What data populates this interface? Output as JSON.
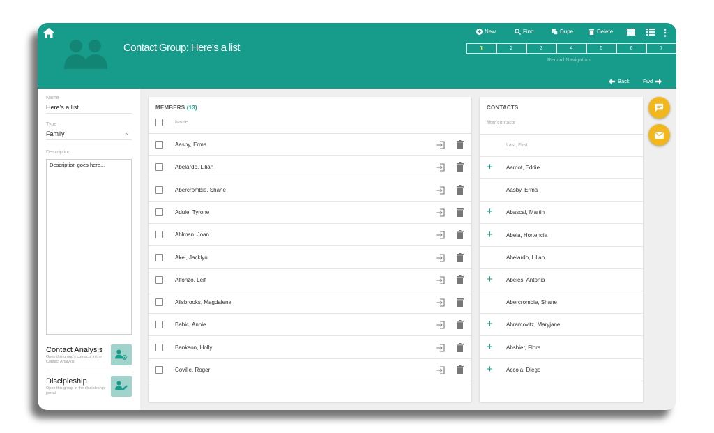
{
  "header": {
    "title": "Contact Group: Here's a list",
    "toolbar": {
      "new": "New",
      "find": "Find",
      "dupe": "Dupe",
      "delete": "Delete"
    },
    "pages": [
      "1",
      "2",
      "3",
      "4",
      "5",
      "6",
      "7"
    ],
    "active_page": "1",
    "record_navigation": "Record Navigation",
    "back": "Back",
    "fwd": "Fwd"
  },
  "left": {
    "name_label": "Name",
    "name_value": "Here's a list",
    "type_label": "Type",
    "type_value": "Family",
    "description_label": "Description",
    "description_value": "Description goes here...",
    "contact_analysis": {
      "title": "Contact Analysis",
      "subtitle": "Open this group's contacts in the Contact Analysis"
    },
    "discipleship": {
      "title": "Discipleship",
      "subtitle": "Open this group in the discipleship portal"
    }
  },
  "members": {
    "title": "MEMBERS",
    "count": "(13)",
    "column_name": "Name",
    "rows": [
      "Aasby, Erma",
      "Abelardo, Lilian",
      "Abercrombie, Shane",
      "Adule, Tyrone",
      "Ahlman, Joan",
      "Akel, Jacklyn",
      "Alfonzo, Leif",
      "Allsbrooks, Magdalena",
      "Babic, Annie",
      "Bankson, Holly",
      "Coville, Roger"
    ]
  },
  "contacts": {
    "title": "CONTACTS",
    "filter_placeholder": "filter contacts",
    "name_placeholder": "Last, First",
    "rows": [
      {
        "name": "Aamot, Eddie",
        "add": true
      },
      {
        "name": "Aasby, Erma",
        "add": false
      },
      {
        "name": "Abascal, Martin",
        "add": true
      },
      {
        "name": "Abela, Hortencia",
        "add": true
      },
      {
        "name": "Abelardo, Lilian",
        "add": false
      },
      {
        "name": "Abeles, Antonia",
        "add": true
      },
      {
        "name": "Abercrombie, Shane",
        "add": false
      },
      {
        "name": "Abramovitz, Maryjane",
        "add": true
      },
      {
        "name": "Abshier, Flora",
        "add": true
      },
      {
        "name": "Accola, Diego",
        "add": true
      }
    ]
  },
  "colors": {
    "teal": "#179b8a",
    "accent_yellow": "#f2b71c",
    "active_page": "#ffeb5a"
  }
}
